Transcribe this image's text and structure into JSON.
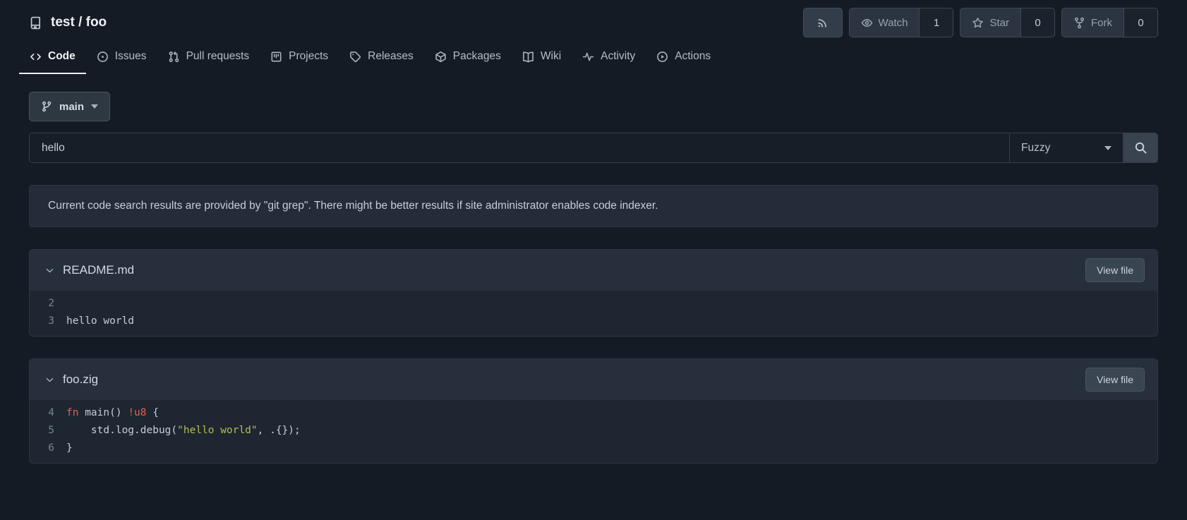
{
  "repo": {
    "title": "test / foo"
  },
  "header_actions": {
    "rss": {
      "icon": "rss-icon"
    },
    "buttons": [
      {
        "name": "watch",
        "icon": "eye-icon",
        "label": "Watch",
        "count": "1"
      },
      {
        "name": "star",
        "icon": "star-icon",
        "label": "Star",
        "count": "0"
      },
      {
        "name": "fork",
        "icon": "fork-icon",
        "label": "Fork",
        "count": "0"
      }
    ]
  },
  "tabs": [
    {
      "name": "code",
      "icon": "code-icon",
      "label": "Code",
      "active": true
    },
    {
      "name": "issues",
      "icon": "issue-icon",
      "label": "Issues",
      "active": false
    },
    {
      "name": "pull-requests",
      "icon": "pull-request-icon",
      "label": "Pull requests",
      "active": false
    },
    {
      "name": "projects",
      "icon": "project-icon",
      "label": "Projects",
      "active": false
    },
    {
      "name": "releases",
      "icon": "tag-icon",
      "label": "Releases",
      "active": false
    },
    {
      "name": "packages",
      "icon": "package-icon",
      "label": "Packages",
      "active": false
    },
    {
      "name": "wiki",
      "icon": "book-icon",
      "label": "Wiki",
      "active": false
    },
    {
      "name": "activity",
      "icon": "pulse-icon",
      "label": "Activity",
      "active": false
    },
    {
      "name": "actions",
      "icon": "play-circle-icon",
      "label": "Actions",
      "active": false
    }
  ],
  "branch": {
    "label": "main",
    "icon": "git-branch-icon"
  },
  "search": {
    "value": "hello",
    "mode_label": "Fuzzy",
    "button_icon": "search-icon"
  },
  "notice": "Current code search results are provided by \"git grep\". There might be better results if site administrator enables code indexer.",
  "results": [
    {
      "file": "README.md",
      "view_file_label": "View file",
      "lines": [
        {
          "num": "2",
          "segments": []
        },
        {
          "num": "3",
          "segments": [
            {
              "text": "hello world",
              "cls": "plain"
            }
          ]
        }
      ]
    },
    {
      "file": "foo.zig",
      "view_file_label": "View file",
      "lines": [
        {
          "num": "4",
          "segments": [
            {
              "text": "fn",
              "cls": "kw"
            },
            {
              "text": " main() ",
              "cls": "plain"
            },
            {
              "text": "!u8",
              "cls": "kw"
            },
            {
              "text": " {",
              "cls": "plain"
            }
          ]
        },
        {
          "num": "5",
          "segments": [
            {
              "text": "    std.log.debug(",
              "cls": "plain"
            },
            {
              "text": "\"hello world\"",
              "cls": "str"
            },
            {
              "text": ", .{});",
              "cls": "plain"
            }
          ]
        },
        {
          "num": "6",
          "segments": [
            {
              "text": "}",
              "cls": "plain"
            }
          ]
        }
      ]
    }
  ],
  "colors": {
    "background": "#151b24",
    "panel_header": "#262f3b",
    "code_background": "#1e2632",
    "keyword": "#ee5f48",
    "string": "#b6bc4f",
    "active_tab_underline": "#eceff3"
  }
}
